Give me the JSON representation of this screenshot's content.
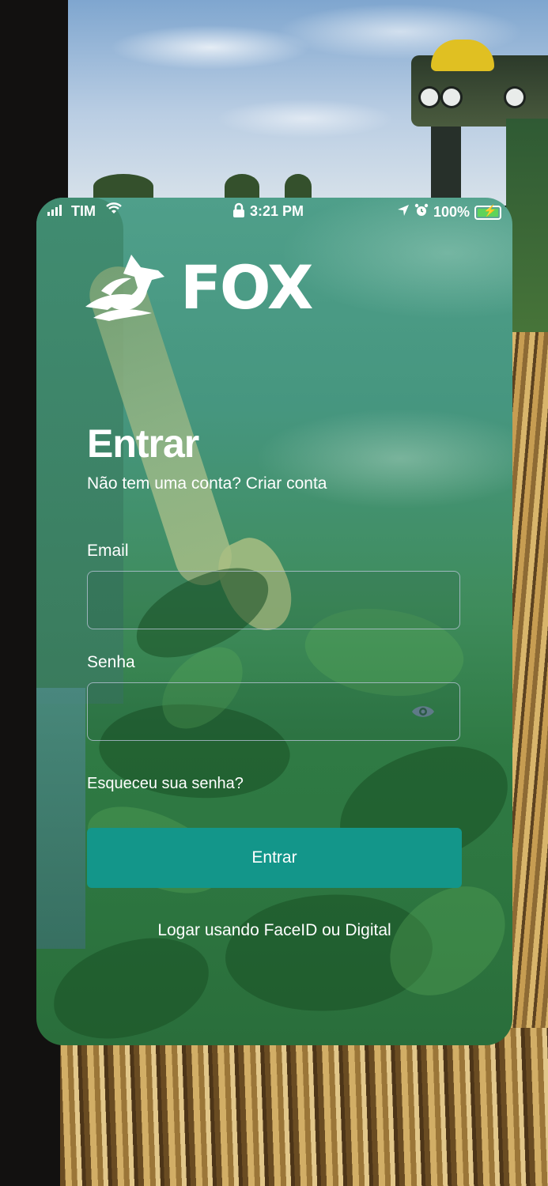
{
  "status_bar": {
    "carrier": "TIM",
    "time": "3:21 PM",
    "battery": "100%",
    "icons": [
      "signal-icon",
      "wifi-icon",
      "lock-icon",
      "location-icon",
      "alarm-icon",
      "battery-icon"
    ]
  },
  "brand": {
    "name": "FOX",
    "logo_icon": "fox-logo-icon"
  },
  "login": {
    "title": "Entrar",
    "subtitle_prefix": "Não tem uma conta? ",
    "create_account": "Criar conta",
    "email_label": "Email",
    "email_value": "",
    "password_label": "Senha",
    "password_value": "",
    "forgot_password": "Esqueceu sua senha?",
    "submit_label": "Entrar",
    "biometric_label": "Logar usando FaceID ou Digital"
  },
  "colors": {
    "button": "#13968a",
    "card_tint": "#3f8c5c",
    "text": "#ffffff"
  }
}
